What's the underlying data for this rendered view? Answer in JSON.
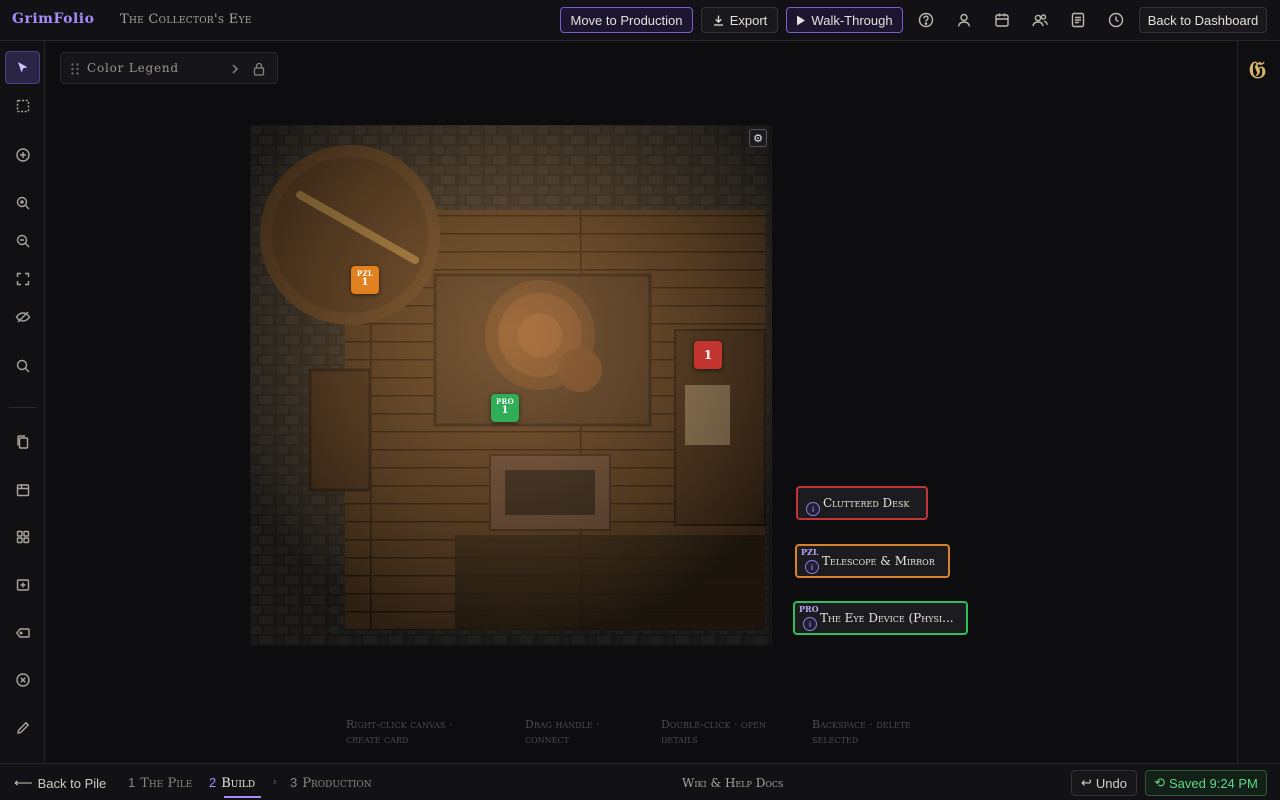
{
  "app": {
    "brand": "GrimFolio",
    "project_title": "The Collector's Eye"
  },
  "topbar": {
    "move_label": "Move to Production",
    "export_label": "Export",
    "walk_label": "Walk-Through",
    "back_label": "Back to Dashboard",
    "icons": [
      "help-icon",
      "user-icon",
      "calendar-icon",
      "users-icon",
      "document-icon",
      "clock-icon"
    ]
  },
  "leftbar": {
    "tools": [
      "select-tool",
      "marquee-select-tool",
      "add-tool",
      "zoom-in-tool",
      "zoom-out-tool",
      "fit-screen-tool",
      "hide-tool",
      "search-tool",
      "copy-tool",
      "box-tool",
      "grid-tool",
      "import-tool",
      "tag-tool",
      "remove-tool",
      "edit-tool"
    ]
  },
  "legend": {
    "label": "Color Legend"
  },
  "pins": [
    {
      "tag": "PZL",
      "number": "1",
      "color": "#e0801f"
    },
    {
      "tag": "",
      "number": "1",
      "color": "#c3362f"
    },
    {
      "tag": "PRO",
      "number": "1",
      "color": "#2fae56"
    }
  ],
  "cards": [
    {
      "badge": "",
      "label": "Cluttered Desk",
      "color": "#c0353a"
    },
    {
      "badge": "PZL",
      "label": "Telescope & Mirror",
      "color": "#d8822a"
    },
    {
      "badge": "PRO",
      "label": "The Eye Device (Physi...",
      "color": "#2fbf5d"
    }
  ],
  "card_info_glyph": "i",
  "hints": [
    {
      "line1": "Right-click canvas ·",
      "line2": "create card"
    },
    {
      "line1": "Drag handle ·",
      "line2": "connect"
    },
    {
      "line1": "Double-click · open",
      "line2": "details"
    },
    {
      "line1": "Backspace · delete",
      "line2": "selected"
    }
  ],
  "bottombar": {
    "back_label": "Back to Pile",
    "steps": [
      {
        "num": "1",
        "label": "The Pile"
      },
      {
        "num": "2",
        "label": "Build"
      },
      {
        "num": "3",
        "label": "Production"
      }
    ],
    "wiki_label": "Wiki & Help Docs",
    "undo_label": "Undo",
    "saved_label": "Saved 9:24 PM"
  },
  "colors": {
    "accent": "#a78bfa",
    "puzzle": "#d8822a",
    "prop": "#2fbf5d",
    "scene": "#c0353a",
    "saved": "#5fd68a"
  }
}
